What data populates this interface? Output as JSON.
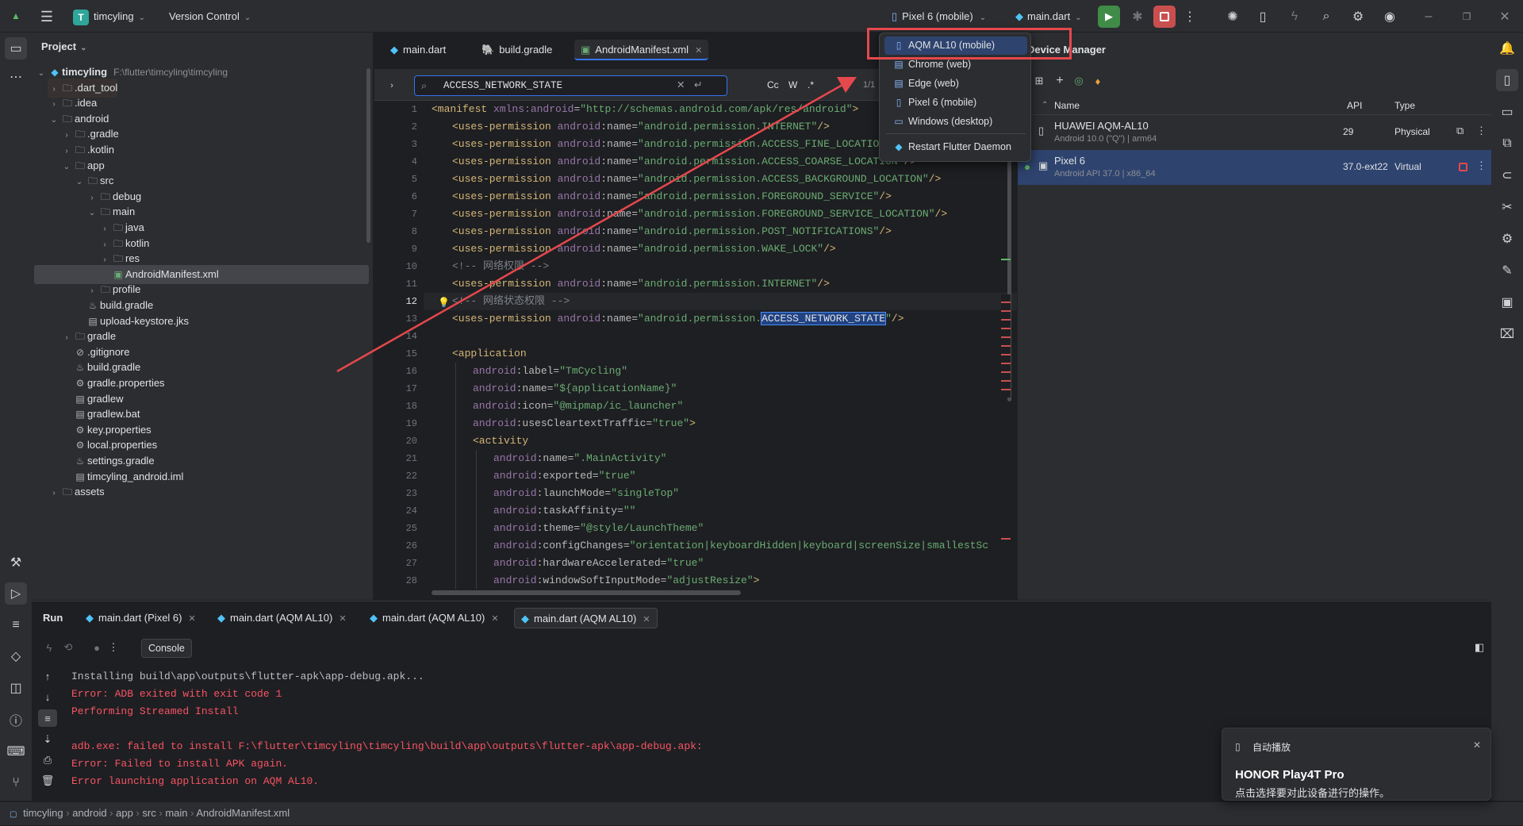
{
  "titlebar": {
    "project_badge": "T",
    "project_name": "timcyling",
    "vcs": "Version Control",
    "device_selector": "Pixel 6 (mobile)",
    "run_config": "main.dart"
  },
  "project": {
    "title": "Project",
    "tree": [
      {
        "label": "timcyling",
        "hint": "F:\\flutter\\timcyling\\timcyling",
        "depth": 0,
        "icon": "module",
        "open": true
      },
      {
        "label": ".dart_tool",
        "depth": 1,
        "icon": "folder",
        "closed": true
      },
      {
        "label": ".idea",
        "depth": 1,
        "icon": "folder",
        "closed": true
      },
      {
        "label": "android",
        "depth": 1,
        "icon": "folder",
        "open": true
      },
      {
        "label": ".gradle",
        "depth": 2,
        "icon": "folder",
        "closed": true
      },
      {
        "label": ".kotlin",
        "depth": 2,
        "icon": "folder",
        "closed": true
      },
      {
        "label": "app",
        "depth": 2,
        "icon": "folder",
        "open": true
      },
      {
        "label": "src",
        "depth": 3,
        "icon": "folder",
        "open": true
      },
      {
        "label": "debug",
        "depth": 4,
        "icon": "folder",
        "closed": true
      },
      {
        "label": "main",
        "depth": 4,
        "icon": "folder",
        "open": true
      },
      {
        "label": "java",
        "depth": 5,
        "icon": "folder",
        "closed": true
      },
      {
        "label": "kotlin",
        "depth": 5,
        "icon": "folder",
        "closed": true
      },
      {
        "label": "res",
        "depth": 5,
        "icon": "folder",
        "closed": true
      },
      {
        "label": "AndroidManifest.xml",
        "depth": 5,
        "icon": "manifest",
        "leaf": true
      },
      {
        "label": "profile",
        "depth": 4,
        "icon": "folder",
        "closed": true
      },
      {
        "label": "build.gradle",
        "depth": 3,
        "icon": "gradle",
        "leaf": true
      },
      {
        "label": "upload-keystore.jks",
        "depth": 3,
        "icon": "file",
        "leaf": true
      },
      {
        "label": "gradle",
        "depth": 2,
        "icon": "folder",
        "closed": true
      },
      {
        "label": ".gitignore",
        "depth": 2,
        "icon": "ignore",
        "leaf": true
      },
      {
        "label": "build.gradle",
        "depth": 2,
        "icon": "gradle",
        "leaf": true
      },
      {
        "label": "gradle.properties",
        "depth": 2,
        "icon": "gear",
        "leaf": true
      },
      {
        "label": "gradlew",
        "depth": 2,
        "icon": "terminal",
        "leaf": true
      },
      {
        "label": "gradlew.bat",
        "depth": 2,
        "icon": "file",
        "leaf": true
      },
      {
        "label": "key.properties",
        "depth": 2,
        "icon": "gear",
        "leaf": true
      },
      {
        "label": "local.properties",
        "depth": 2,
        "icon": "gear",
        "leaf": true
      },
      {
        "label": "settings.gradle",
        "depth": 2,
        "icon": "gradle",
        "leaf": true
      },
      {
        "label": "timcyling_android.iml",
        "depth": 2,
        "icon": "file",
        "leaf": true
      },
      {
        "label": "assets",
        "depth": 1,
        "icon": "folder",
        "closed": true
      }
    ]
  },
  "editor": {
    "tabs": [
      "main.dart",
      "build.gradle",
      "AndroidManifest.xml"
    ],
    "search_query": "ACCESS_NETWORK_STATE",
    "search_count": "1/1",
    "search_opts": [
      "Cc",
      "W",
      ".*"
    ],
    "lines": [
      {
        "n": "1",
        "i": 0,
        "parts": [
          [
            "tag",
            "<manifest "
          ],
          [
            "attrns",
            "xmlns:android"
          ],
          [
            "attr",
            "="
          ],
          [
            "str",
            "\"http://schemas.android.com/apk/res/android\""
          ],
          [
            "tag",
            ">"
          ]
        ]
      },
      {
        "n": "2",
        "i": 1,
        "parts": [
          [
            "tag",
            "<uses-permission "
          ],
          [
            "attrns",
            "android"
          ],
          [
            "attr",
            ":name="
          ],
          [
            "str",
            "\"android.permission.INTERNET\""
          ],
          [
            "tag",
            "/>"
          ]
        ]
      },
      {
        "n": "3",
        "i": 1,
        "parts": [
          [
            "tag",
            "<uses-permission "
          ],
          [
            "attrns",
            "android"
          ],
          [
            "attr",
            ":name="
          ],
          [
            "str",
            "\"android.permission.ACCESS_FINE_LOCATION\""
          ],
          [
            "tag",
            "/>"
          ]
        ]
      },
      {
        "n": "4",
        "i": 1,
        "parts": [
          [
            "tag",
            "<uses-permission "
          ],
          [
            "attrns",
            "android"
          ],
          [
            "attr",
            ":name="
          ],
          [
            "str",
            "\"android.permission.ACCESS_COARSE_LOCATION\""
          ],
          [
            "tag",
            "/>"
          ]
        ]
      },
      {
        "n": "5",
        "i": 1,
        "parts": [
          [
            "tag",
            "<uses-permission "
          ],
          [
            "attrns",
            "android"
          ],
          [
            "attr",
            ":name="
          ],
          [
            "str",
            "\"android.permission.ACCESS_BACKGROUND_LOCATION\""
          ],
          [
            "tag",
            "/>"
          ]
        ]
      },
      {
        "n": "6",
        "i": 1,
        "parts": [
          [
            "tag",
            "<uses-permission "
          ],
          [
            "attrns",
            "android"
          ],
          [
            "attr",
            ":name="
          ],
          [
            "str",
            "\"android.permission.FOREGROUND_SERVICE\""
          ],
          [
            "tag",
            "/>"
          ]
        ]
      },
      {
        "n": "7",
        "i": 1,
        "parts": [
          [
            "tag",
            "<uses-permission "
          ],
          [
            "attrns",
            "android"
          ],
          [
            "attr",
            ":name="
          ],
          [
            "str",
            "\"android.permission.FOREGROUND_SERVICE_LOCATION\""
          ],
          [
            "tag",
            "/>"
          ]
        ]
      },
      {
        "n": "8",
        "i": 1,
        "parts": [
          [
            "tag",
            "<uses-permission "
          ],
          [
            "attrns",
            "android"
          ],
          [
            "attr",
            ":name="
          ],
          [
            "str",
            "\"android.permission.POST_NOTIFICATIONS\""
          ],
          [
            "tag",
            "/>"
          ]
        ]
      },
      {
        "n": "9",
        "i": 1,
        "parts": [
          [
            "tag",
            "<uses-permission "
          ],
          [
            "attrns",
            "android"
          ],
          [
            "attr",
            ":name="
          ],
          [
            "str",
            "\"android.permission.WAKE_LOCK\""
          ],
          [
            "tag",
            "/>"
          ]
        ]
      },
      {
        "n": "10",
        "i": 1,
        "parts": [
          [
            "cmt",
            "<!-- 网络权限 -->"
          ]
        ]
      },
      {
        "n": "11",
        "i": 1,
        "parts": [
          [
            "tag",
            "<uses-permission "
          ],
          [
            "attrns",
            "android"
          ],
          [
            "attr",
            ":name="
          ],
          [
            "str",
            "\"android.permission.INTERNET\""
          ],
          [
            "tag",
            "/>"
          ]
        ]
      },
      {
        "n": "12",
        "i": 1,
        "parts": [
          [
            "cmt",
            "<!-- 网络状态权限 -->"
          ]
        ]
      },
      {
        "n": "13",
        "i": 1,
        "parts": [
          [
            "tag",
            "<uses-permission "
          ],
          [
            "attrns",
            "android"
          ],
          [
            "attr",
            ":name="
          ],
          [
            "str",
            "\"android.permission."
          ],
          [
            "hl",
            "ACCESS_NETWORK_STATE"
          ],
          [
            "str",
            "\""
          ],
          [
            "tag",
            "/>"
          ]
        ]
      },
      {
        "n": "14",
        "i": 0,
        "parts": []
      },
      {
        "n": "15",
        "i": 1,
        "parts": [
          [
            "tag",
            "<application"
          ]
        ]
      },
      {
        "n": "16",
        "i": 2,
        "parts": [
          [
            "attrns",
            "android"
          ],
          [
            "attr",
            ":label="
          ],
          [
            "str",
            "\"TmCycling\""
          ]
        ]
      },
      {
        "n": "17",
        "i": 2,
        "parts": [
          [
            "attrns",
            "android"
          ],
          [
            "attr",
            ":name="
          ],
          [
            "str",
            "\"${applicationName}\""
          ]
        ]
      },
      {
        "n": "18",
        "i": 2,
        "parts": [
          [
            "attrns",
            "android"
          ],
          [
            "attr",
            ":icon="
          ],
          [
            "str",
            "\"@mipmap/ic_launcher\""
          ]
        ]
      },
      {
        "n": "19",
        "i": 2,
        "parts": [
          [
            "attrns",
            "android"
          ],
          [
            "attr",
            ":usesCleartextTraffic="
          ],
          [
            "str",
            "\"true\""
          ],
          [
            "tag",
            ">"
          ]
        ]
      },
      {
        "n": "20",
        "i": 2,
        "parts": [
          [
            "tag",
            "<activity"
          ]
        ]
      },
      {
        "n": "21",
        "i": 3,
        "parts": [
          [
            "attrns",
            "android"
          ],
          [
            "attr",
            ":name="
          ],
          [
            "str",
            "\".MainActivity\""
          ]
        ]
      },
      {
        "n": "22",
        "i": 3,
        "parts": [
          [
            "attrns",
            "android"
          ],
          [
            "attr",
            ":exported="
          ],
          [
            "str",
            "\"true\""
          ]
        ]
      },
      {
        "n": "23",
        "i": 3,
        "parts": [
          [
            "attrns",
            "android"
          ],
          [
            "attr",
            ":launchMode="
          ],
          [
            "str",
            "\"singleTop\""
          ]
        ]
      },
      {
        "n": "24",
        "i": 3,
        "parts": [
          [
            "attrns",
            "android"
          ],
          [
            "attr",
            ":taskAffinity="
          ],
          [
            "str",
            "\"\""
          ]
        ]
      },
      {
        "n": "25",
        "i": 3,
        "parts": [
          [
            "attrns",
            "android"
          ],
          [
            "attr",
            ":theme="
          ],
          [
            "str",
            "\"@style/LaunchTheme\""
          ]
        ]
      },
      {
        "n": "26",
        "i": 3,
        "parts": [
          [
            "attrns",
            "android"
          ],
          [
            "attr",
            ":configChanges="
          ],
          [
            "str",
            "\"orientation|keyboardHidden|keyboard|screenSize|smallestSc"
          ]
        ]
      },
      {
        "n": "27",
        "i": 3,
        "parts": [
          [
            "attrns",
            "android"
          ],
          [
            "attr",
            ":hardwareAccelerated="
          ],
          [
            "str",
            "\"true\""
          ]
        ]
      },
      {
        "n": "28",
        "i": 3,
        "parts": [
          [
            "attrns",
            "android"
          ],
          [
            "attr",
            ":windowSoftInputMode="
          ],
          [
            "str",
            "\"adjustResize\""
          ],
          [
            "tag",
            ">"
          ]
        ]
      }
    ]
  },
  "device_manager": {
    "title": "Device Manager",
    "columns": [
      "Name",
      "API",
      "Type"
    ],
    "devices": [
      {
        "name": "HUAWEI AQM-AL10",
        "sub": "Android 10.0 (\"Q\") | arm64",
        "api": "29",
        "type": "Physical"
      },
      {
        "name": "Pixel 6",
        "sub": "Android API 37.0 | x86_64",
        "api": "37.0-ext22",
        "type": "Virtual"
      }
    ]
  },
  "device_dropdown": {
    "items": [
      {
        "label": "AQM AL10 (mobile)",
        "icon": "phone-icon"
      },
      {
        "label": "Chrome (web)",
        "icon": "browser-icon"
      },
      {
        "label": "Edge (web)",
        "icon": "browser-icon"
      },
      {
        "label": "Pixel 6 (mobile)",
        "icon": "phone-icon"
      },
      {
        "label": "Windows (desktop)",
        "icon": "desktop-icon"
      }
    ],
    "action": "Restart Flutter Daemon"
  },
  "run": {
    "title": "Run",
    "tabs": [
      "main.dart (Pixel 6)",
      "main.dart (AQM AL10)",
      "main.dart (AQM AL10)",
      "main.dart (AQM AL10)"
    ],
    "console_btn": "Console",
    "output": [
      {
        "text": "Installing build\\app\\outputs\\flutter-apk\\app-debug.apk...",
        "err": false
      },
      {
        "text": "Error: ADB exited with exit code 1",
        "err": true
      },
      {
        "text": "Performing Streamed Install",
        "err": true
      },
      {
        "text": "",
        "err": false
      },
      {
        "text": "adb.exe: failed to install F:\\flutter\\timcyling\\timcyling\\build\\app\\outputs\\flutter-apk\\app-debug.apk:",
        "err": true
      },
      {
        "text": "Error: Failed to install APK again.",
        "err": true
      },
      {
        "text": "Error launching application on AQM AL10.",
        "err": true
      }
    ]
  },
  "notification": {
    "title": "自动播放",
    "device": "HONOR Play4T Pro",
    "message": "点击选择要对此设备进行的操作。"
  },
  "statusbar": {
    "crumbs": [
      "timcyling",
      "android",
      "app",
      "src",
      "main",
      "AndroidManifest.xml"
    ]
  },
  "colors": {
    "accent": "#3574f0",
    "error": "#f75464",
    "annotation": "#e5484d",
    "run_green": "#5fb865"
  }
}
